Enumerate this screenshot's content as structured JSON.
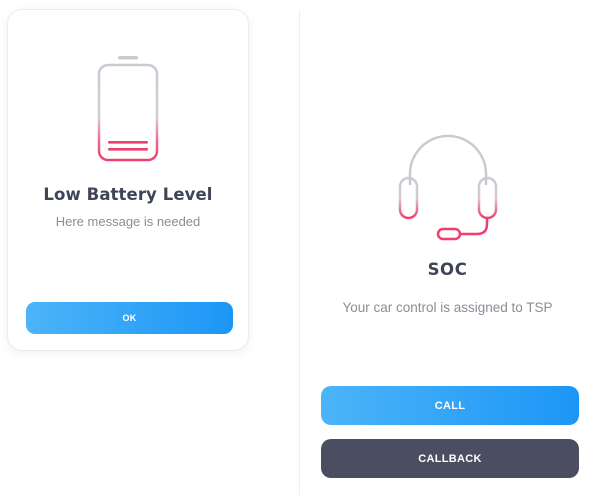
{
  "colors": {
    "accent_blue": "#1c96f6",
    "accent_blue_light": "#4cb4f8",
    "warning_pink": "#ee3f6f",
    "icon_gray": "#c9cbd3",
    "dark_button": "#4b4e60",
    "title_text": "#3f4456",
    "body_text": "#8a8d96"
  },
  "low_battery_dialog": {
    "icon": "low-battery-icon",
    "title": "Low Battery Level",
    "message": "Here message is needed",
    "ok_label": "OK"
  },
  "soc_dialog": {
    "icon": "headset-icon",
    "title": "SOC",
    "message": "Your car control is assigned to TSP",
    "call_label": "CALL",
    "callback_label": "CALLBACK"
  }
}
